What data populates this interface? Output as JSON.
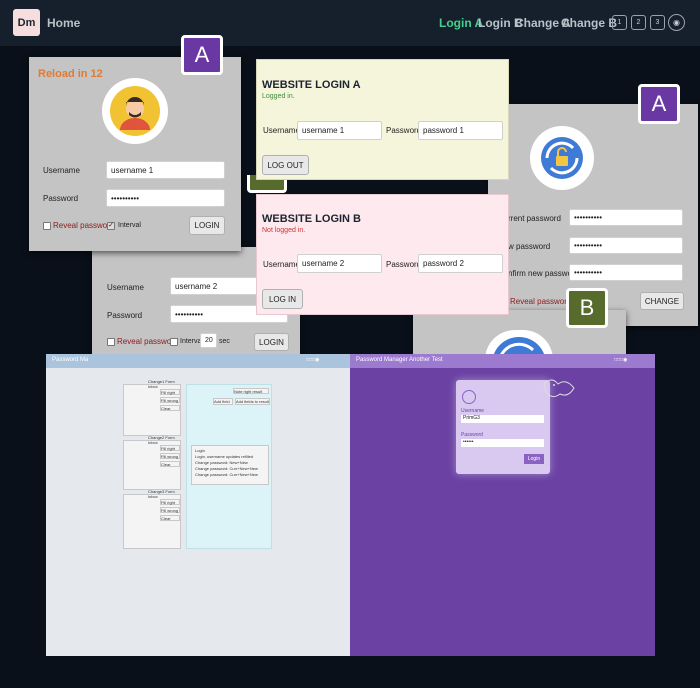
{
  "nav": {
    "brand": "Dm",
    "home": "Home",
    "links": [
      "Login A",
      "Login B",
      "Change A",
      "Change B"
    ],
    "active": "Login A",
    "numbers": [
      "1",
      "2",
      "3"
    ]
  },
  "panel_a": {
    "reload_text": "Reload in 12",
    "badge": "A",
    "username_label": "Username",
    "username_value": "username 1",
    "password_label": "Password",
    "password_value": "••••••••••",
    "reveal_label": "Reveal password",
    "interval_label": "Interval",
    "login_button": "LOGIN"
  },
  "panel_b": {
    "username_label": "Username",
    "username_value": "username 2",
    "password_label": "Password",
    "password_value": "••••••••••",
    "reveal_label": "Reveal password",
    "interval_label": "Interval",
    "interval_value": "20",
    "sec_label": "sec",
    "login_button": "LOGIN"
  },
  "site_a": {
    "title": "WEBSITE LOGIN A",
    "status": "Logged in.",
    "username_label": "Username",
    "username_value": "username 1",
    "password_label": "Password",
    "password_value": "password 1",
    "button": "LOG OUT"
  },
  "site_b": {
    "title": "WEBSITE LOGIN B",
    "status": "Not logged in.",
    "username_label": "Username",
    "username_value": "username 2",
    "password_label": "Password",
    "password_value": "password 2",
    "button": "LOG IN"
  },
  "change_a": {
    "badge": "A",
    "current_label": "rrent password",
    "new_label": "w password",
    "confirm_label": "nfirm new password",
    "current_value": "••••••••••",
    "new_value": "••••••••••",
    "confirm_value": "••••••••••",
    "reveal_label": "Reveal password",
    "change_button": "CHANGE"
  },
  "change_b": {
    "badge": "B"
  },
  "bottom_left": {
    "title": "Password Ma",
    "group_headers": [
      "Change1 Form Inbox",
      "Change2 Form Inbox",
      "Change3 Form Inbox"
    ],
    "fill_right": "Fill right",
    "fill_wrong": "Fill wrong",
    "clear": "Clear",
    "add_field": "Add field",
    "add_fields_to_result": "Add fields to result",
    "note_right": "Note right result",
    "checklist": [
      "Login",
      "Login, username updates refilled",
      "Change password: New+New",
      "Change password: Curr+New+New",
      "Change password: Curr+New+New"
    ]
  },
  "bottom_right": {
    "title": "Password Manager Another Test",
    "username_label": "Username",
    "username_value": "PrimG3",
    "password_label": "Password",
    "password_value": "••••••",
    "login_button": "Login"
  },
  "colors": {
    "nav_active": "#43d08c",
    "badge_a": "#6a38a2",
    "badge_b": "#566b2c",
    "reload": "#e07b32",
    "site_a_bg": "#f5f5dc",
    "site_b_bg": "#fde9ee",
    "logged_in": "#3d8b3d",
    "not_logged_in": "#d0302f"
  }
}
